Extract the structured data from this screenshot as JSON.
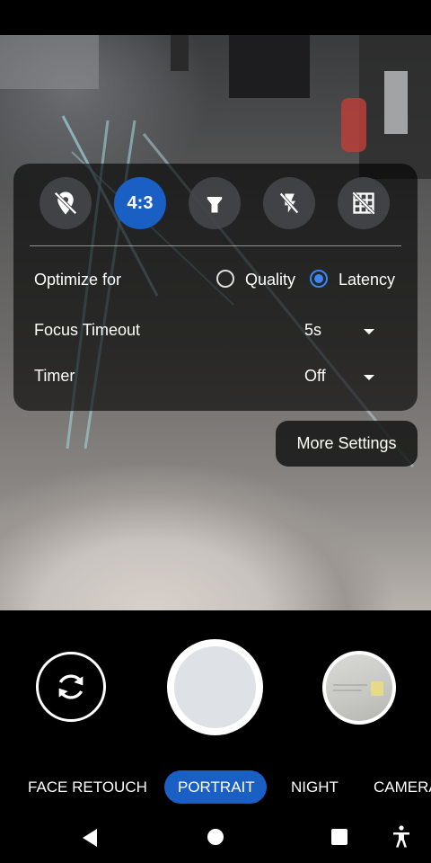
{
  "quick_settings": {
    "ratio_label": "4:3",
    "icons": [
      "location-off-icon",
      "aspect-ratio-icon",
      "flashlight-icon",
      "flash-off-icon",
      "grid-off-icon"
    ]
  },
  "options": {
    "optimize_label": "Optimize for",
    "quality_label": "Quality",
    "latency_label": "Latency",
    "selected": "Latency",
    "focus_label": "Focus Timeout",
    "focus_value": "5s",
    "timer_label": "Timer",
    "timer_value": "Off"
  },
  "more_settings_label": "More Settings",
  "modes": [
    "FACE RETOUCH",
    "PORTRAIT",
    "NIGHT",
    "CAMERA"
  ],
  "selected_mode": "PORTRAIT",
  "colors": {
    "accent": "#1a5fc4",
    "radio_checked": "#3b86f0"
  }
}
